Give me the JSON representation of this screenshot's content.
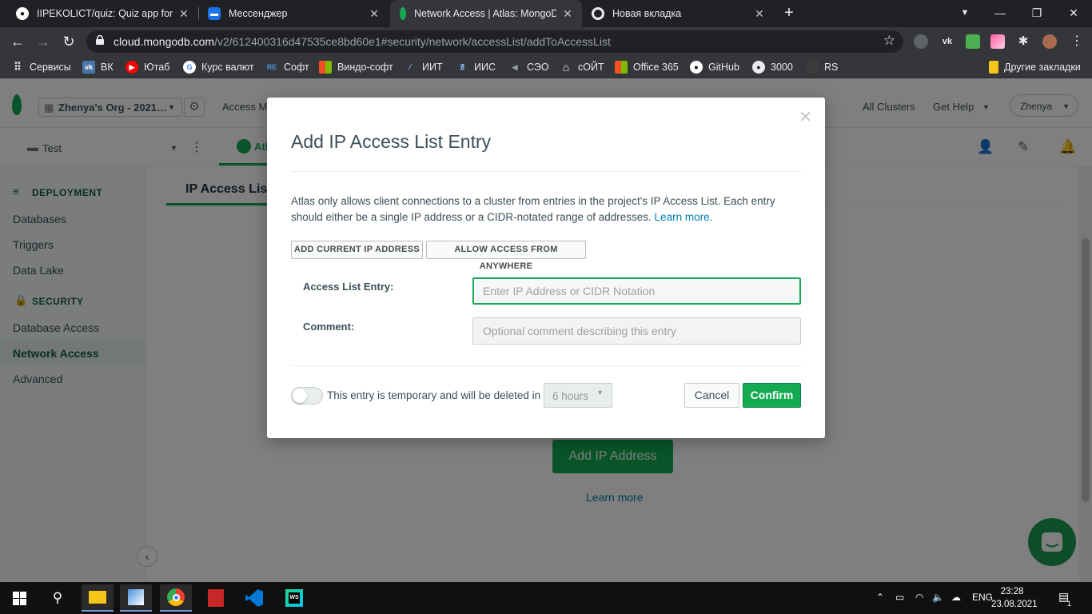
{
  "browser": {
    "tabs": [
      {
        "title": "IIPEKOLICT/quiz: Quiz app for ar",
        "icon": "github-icon"
      },
      {
        "title": "Мессенджер",
        "icon": "messenger-icon"
      },
      {
        "title": "Network Access | Atlas: MongoD",
        "icon": "mongodb-leaf-icon"
      },
      {
        "title": "Новая вкладка",
        "icon": "chrome-icon"
      }
    ],
    "url_host": "cloud.mongodb.com",
    "url_path": "/v2/612400316d47535ce8bd60e1#security/network/accessList/addToAccessList",
    "bookmarks": [
      "Сервисы",
      "ВК",
      "Ютаб",
      "Курс валют",
      "Софт",
      "Виндо-софт",
      "ИИТ",
      "ИИС",
      "СЭО",
      "сОЙТ",
      "Office 365",
      "GitHub",
      "3000",
      "RS"
    ],
    "other_bookmarks": "Другие закладки"
  },
  "atlas": {
    "org": "Zhenya's Org - 2021…",
    "access_manager": "Access M",
    "all_clusters": "All Clusters",
    "get_help": "Get Help",
    "user": "Zhenya",
    "project": "Test",
    "atlas_tab": "Atl",
    "sidebar": {
      "deployment_header": "DEPLOYMENT",
      "deployment_items": [
        "Databases",
        "Triggers",
        "Data Lake"
      ],
      "security_header": "SECURITY",
      "security_items": [
        "Database Access",
        "Network Access",
        "Advanced"
      ]
    },
    "main_tab": "IP Access Lis",
    "add_ip_button": "Add IP Address",
    "learn_more": "Learn more"
  },
  "modal": {
    "title": "Add IP Access List Entry",
    "description": "Atlas only allows client connections to a cluster from entries in the project's IP Access List. Each entry should either be a single IP address or a CIDR-notated range of addresses.",
    "learn_more": "Learn more.",
    "add_current_ip": "ADD CURRENT IP ADDRESS",
    "allow_anywhere": "ALLOW ACCESS FROM ANYWHERE",
    "entry_label": "Access List Entry:",
    "entry_placeholder": "Enter IP Address or CIDR Notation",
    "entry_value": "",
    "comment_label": "Comment:",
    "comment_placeholder": "Optional comment describing this entry",
    "comment_value": "",
    "temporary_text": "This entry is temporary and will be deleted in",
    "temporary_enabled": false,
    "hours_value": "6 hours",
    "cancel": "Cancel",
    "confirm": "Confirm"
  },
  "taskbar": {
    "language": "ENG",
    "time": "23:28",
    "date": "23.08.2021",
    "notifications": "1"
  },
  "colors": {
    "accent_green": "#13aa52",
    "link_blue": "#007cad",
    "text": "#3d4f58"
  }
}
